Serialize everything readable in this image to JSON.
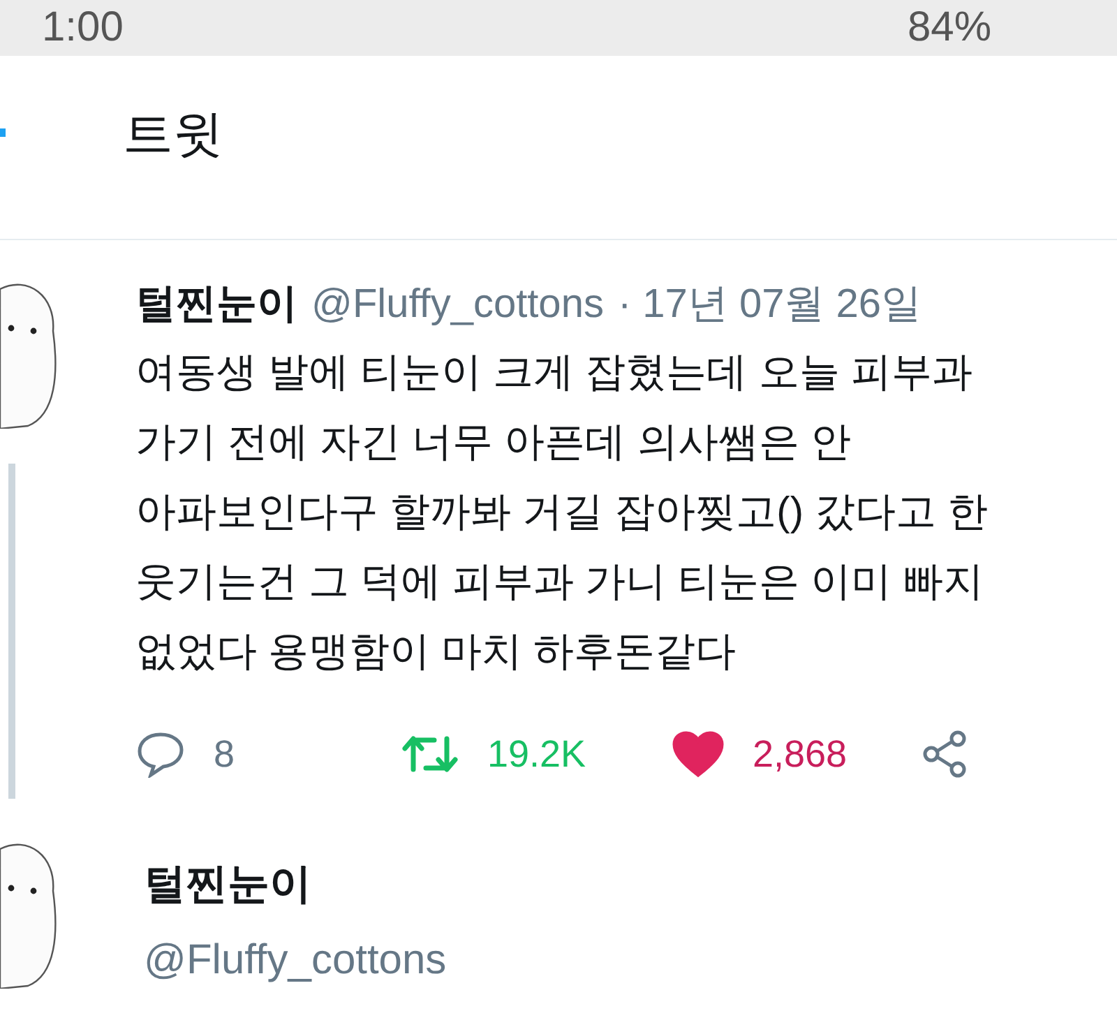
{
  "status_bar": {
    "time": "1:00",
    "battery": "84%"
  },
  "header": {
    "title": "트윗"
  },
  "tweet": {
    "name": "털찐눈이",
    "handle": "@Fluffy_cottons",
    "date": "· 17년 07월 26일",
    "text_lines": [
      "여동생 발에 티눈이 크게 잡혔는데 오늘 피부과",
      "가기 전에 자긴 너무 아픈데 의사쌤은 안",
      "아파보인다구 할까봐 거길 잡아찢고() 갔다고 한",
      "웃기는건 그 덕에 피부과 가니 티눈은 이미 빠지",
      "없었다 용맹함이 마치 하후돈같다"
    ],
    "replies": "8",
    "retweets": "19.2K",
    "retweeted": true,
    "likes": "2,868",
    "liked": true
  },
  "next_tweet": {
    "name": "털찐눈이",
    "handle": "@Fluffy_cottons"
  }
}
